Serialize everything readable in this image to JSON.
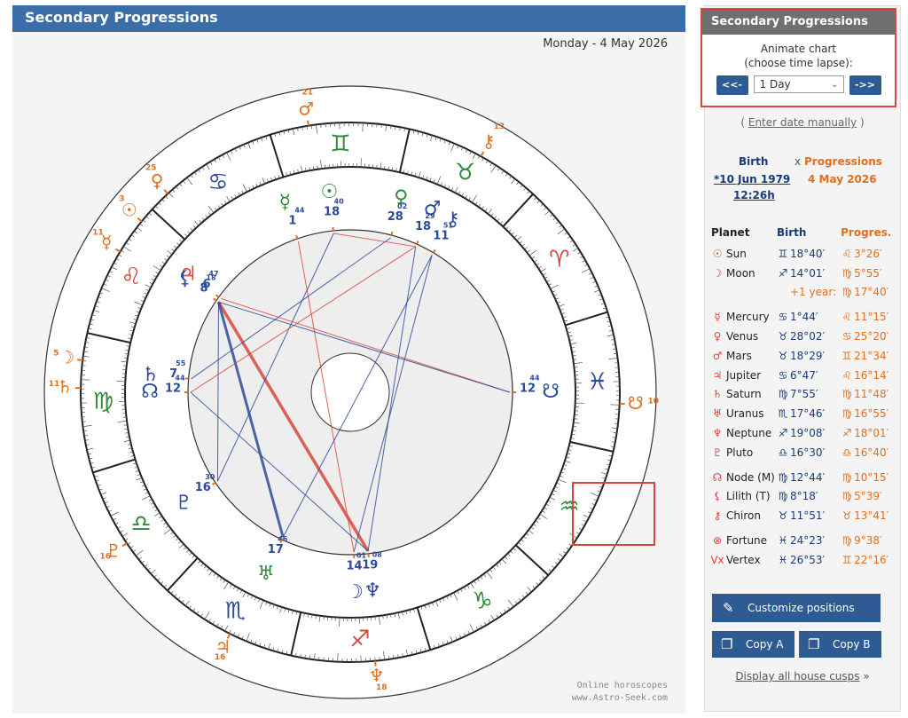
{
  "header": {
    "title": "Secondary Progressions"
  },
  "chart": {
    "date": "Monday - 4 May 2026",
    "watermark1": "Online horoscopes",
    "watermark2": "www.Astro-Seek.com",
    "signs": [
      "♈",
      "♉",
      "♊",
      "♋",
      "♌",
      "♍",
      "♎",
      "♏",
      "♐",
      "♑",
      "♒",
      "♓"
    ],
    "sign_colors": [
      "#d9473b",
      "#2e8b3a",
      "#2e8b3a",
      "#2b4a9a",
      "#d9473b",
      "#2e8b3a",
      "#2e8b3a",
      "#2b4a9a",
      "#d9473b",
      "#2e8b3a",
      "#2e8b3a",
      "#2b4a9a"
    ],
    "inner_planets": [
      {
        "glyph": "♆",
        "deg": "19",
        "min": "08",
        "color": "#2b4a9a",
        "retro": true,
        "lng": 259.1
      },
      {
        "glyph": "☽",
        "deg": "14",
        "min": "01",
        "color": "#2b4a9a",
        "retro": false,
        "lng": 254.0
      },
      {
        "glyph": "♅",
        "deg": "17",
        "min": "46",
        "color": "#2e8b3a",
        "retro": true,
        "lng": 227.8
      },
      {
        "glyph": "♇",
        "deg": "16",
        "min": "30",
        "color": "#2b4a9a",
        "retro": true,
        "lng": 196.5
      },
      {
        "glyph": "☊",
        "deg": "12",
        "min": "44",
        "color": "#2b4a9a",
        "retro": false,
        "lng": 162.7
      },
      {
        "glyph": "♄",
        "deg": "7",
        "min": "55",
        "color": "#2b4a9a",
        "retro": false,
        "lng": 157.9
      },
      {
        "glyph": "♃",
        "deg": "6",
        "min": "47",
        "color": "#d9473b",
        "retro": false,
        "lng": 126.8
      },
      {
        "glyph": "⚸",
        "deg": "8",
        "min": "18",
        "color": "#2b4a9a",
        "retro": true,
        "lng": 128.3
      },
      {
        "glyph": "☉",
        "deg": "18",
        "min": "40",
        "color": "#2e8b3a",
        "retro": false,
        "lng": 78.7
      },
      {
        "glyph": "☿",
        "deg": "1",
        "min": "44",
        "color": "#2e8b3a",
        "retro": false,
        "lng": 91.7
      },
      {
        "glyph": "♀",
        "deg": "28",
        "min": "02",
        "color": "#2e8b3a",
        "retro": false,
        "lng": 58.0
      },
      {
        "glyph": "♂",
        "deg": "18",
        "min": "29",
        "color": "#2b4a9a",
        "retro": false,
        "lng": 48.5
      },
      {
        "glyph": "⚷",
        "deg": "11",
        "min": "51",
        "color": "#2b4a9a",
        "retro": false,
        "lng": 41.9
      },
      {
        "glyph": "☋",
        "deg": "12",
        "min": "44",
        "color": "#2b4a9a",
        "retro": true,
        "lng": 342.7
      }
    ],
    "outer_planets": [
      {
        "glyph": "♆",
        "deg": "18",
        "min": "01",
        "lng": 258.0
      },
      {
        "glyph": "♃",
        "deg": "16",
        "min": "14",
        "lng": 226.2
      },
      {
        "glyph": "♇",
        "deg": "16",
        "min": "40",
        "lng": 196.7
      },
      {
        "glyph": "♄",
        "deg": "11",
        "min": "48",
        "lng": 161.8
      },
      {
        "glyph": "☽",
        "deg": "5",
        "min": "55",
        "lng": 155.9
      },
      {
        "glyph": "☿",
        "deg": "11",
        "min": "15",
        "lng": 131.3
      },
      {
        "glyph": "☉",
        "deg": "3",
        "min": "26",
        "lng": 123.4
      },
      {
        "glyph": "♀",
        "deg": "25",
        "min": "20",
        "lng": 115.3
      },
      {
        "glyph": "♂",
        "deg": "21",
        "min": "34",
        "lng": 81.6
      },
      {
        "glyph": "⚷",
        "deg": "13",
        "min": "41",
        "lng": 43.7
      },
      {
        "glyph": "☋",
        "deg": "10",
        "min": "15",
        "lng": 340.3
      }
    ]
  },
  "panel": {
    "anim_title": "Secondary Progressions",
    "anim_line1": "Animate chart",
    "anim_line2": "(choose time lapse):",
    "prev": "<<-",
    "next": "->>",
    "lapse": "1 Day",
    "enter_open": "( ",
    "enter_link": "Enter date manually",
    "enter_close": " )",
    "birth_head": "Birth",
    "x_sep": "x",
    "prog_head": "Progressions",
    "birth_date": "*10 Jun 1979",
    "birth_time": "12:26h",
    "prog_date": "4 May 2026",
    "col_planet": "Planet",
    "col_birth": "Birth",
    "col_prog": "Progres.",
    "rows": [
      {
        "glyph": "☉",
        "name": "Sun",
        "bsign": "♊",
        "birth": "18°40′",
        "psign": "♌",
        "prog": "3°26′"
      },
      {
        "glyph": "☽",
        "name": "Moon",
        "bsign": "♐",
        "birth": "14°01′",
        "psign": "♍",
        "prog": "5°55′"
      },
      {
        "glyph": "",
        "name": "",
        "bsign": "",
        "birth": "+1 year:",
        "psign": "♍",
        "prog": "17°40′"
      },
      {
        "glyph": "☿",
        "name": "Mercury",
        "bsign": "♋",
        "birth": "1°44′",
        "psign": "♌",
        "prog": "11°15′"
      },
      {
        "glyph": "♀",
        "name": "Venus",
        "bsign": "♉",
        "birth": "28°02′",
        "psign": "♋",
        "prog": "25°20′"
      },
      {
        "glyph": "♂",
        "name": "Mars",
        "bsign": "♉",
        "birth": "18°29′",
        "psign": "♊",
        "prog": "21°34′"
      },
      {
        "glyph": "♃",
        "name": "Jupiter",
        "bsign": "♋",
        "birth": "6°47′",
        "psign": "♌",
        "prog": "16°14′"
      },
      {
        "glyph": "♄",
        "name": "Saturn",
        "bsign": "♍",
        "birth": "7°55′",
        "psign": "♍",
        "prog": "11°48′"
      },
      {
        "glyph": "♅",
        "name": "Uranus",
        "bsign": "♏",
        "birth": "17°46′",
        "psign": "♍",
        "prog": "16°55′"
      },
      {
        "glyph": "♆",
        "name": "Neptune",
        "bsign": "♐",
        "birth": "19°08′",
        "psign": "♐",
        "prog": "18°01′"
      },
      {
        "glyph": "♇",
        "name": "Pluto",
        "bsign": "♎",
        "birth": "16°30′",
        "psign": "♎",
        "prog": "16°40′"
      },
      {
        "glyph": "☊",
        "name": "Node (M)",
        "bsign": "♍",
        "birth": "12°44′",
        "psign": "♍",
        "prog": "10°15′"
      },
      {
        "glyph": "⚸",
        "name": "Lilith (T)",
        "bsign": "♍",
        "birth": "8°18′",
        "psign": "♍",
        "prog": "5°39′"
      },
      {
        "glyph": "⚷",
        "name": "Chiron",
        "bsign": "♉",
        "birth": "11°51′",
        "psign": "♉",
        "prog": "13°41′"
      },
      {
        "glyph": "⊗",
        "name": "Fortune",
        "bsign": "♓",
        "birth": "24°23′",
        "psign": "♍",
        "prog": "9°38′"
      },
      {
        "glyph": "Vx",
        "name": "Vertex",
        "bsign": "♓",
        "birth": "26°53′",
        "psign": "♊",
        "prog": "22°16′"
      }
    ],
    "customize": "Customize positions",
    "copy_a": "Copy A",
    "copy_b": "Copy B",
    "all_cusps": "Display all house cusps",
    "all_cusps_arrow": " »"
  }
}
